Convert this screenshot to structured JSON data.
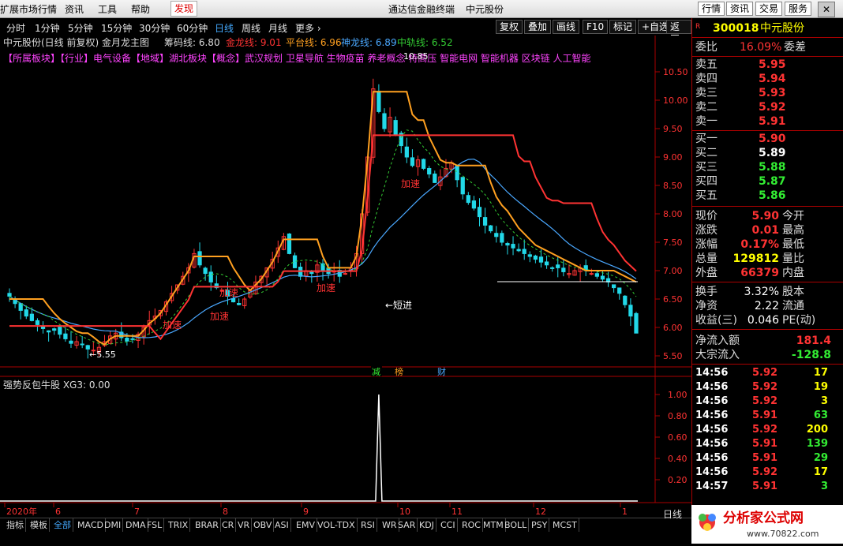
{
  "menubar": {
    "items": [
      "扩展市场行情",
      "资讯",
      "工具",
      "帮助"
    ],
    "active": "发现",
    "title_app": "通达信金融终端",
    "title_stock": "中元股份",
    "right_buttons": [
      "行情",
      "资讯",
      "交易",
      "服务"
    ]
  },
  "periods": [
    "分时",
    "1分钟",
    "5分钟",
    "15分钟",
    "30分钟",
    "60分钟",
    "日线",
    "周线",
    "月线",
    "更多 ›"
  ],
  "selected_period": "日线",
  "toolbar": [
    "复权",
    "叠加",
    "画线",
    "F10",
    "标记",
    "+自选",
    "返回"
  ],
  "chart_header": {
    "title": "中元股份(日线 前复权) 金月龙主图",
    "chouma": "筹码线: 6.80",
    "jinlong": "金龙线: 9.01",
    "pingtai": "平台线: 6.96",
    "shenlong": "神龙线: 6.89",
    "zhonggui": "中轨线: 6.52"
  },
  "concepts": "【所属板块】【行业】电气设备【地域】湖北板块【概念】武汉规划 卫星导航 生物疫苗 养老概念 特高压 智能电网 智能机器 区块链 人工智能",
  "annotations": {
    "high": "10.85",
    "low": "←5.55",
    "short_entry": "←短进",
    "accel": "加速"
  },
  "event_markers": [
    "减",
    "榜",
    "财"
  ],
  "sub_indicator": "强势反包牛股 XG3: 0.00",
  "colors": {
    "up": "#ff3333",
    "down": "#22d8e8",
    "gold": "#ffa020",
    "ma_blue": "#4aa8ff",
    "ma_green": "#33cc33",
    "text_yellow": "#ffff00",
    "text_cyan": "#00dddd",
    "text_magenta": "#ff44ff"
  },
  "chart_data": {
    "type": "line",
    "title": "",
    "x_axis_labels": [
      "2020年",
      "6",
      "7",
      "8",
      "9",
      "10",
      "11",
      "12",
      "1"
    ],
    "price_ticks": [
      "10.50",
      "10.00",
      "9.50",
      "9.00",
      "8.50",
      "8.00",
      "7.50",
      "7.00",
      "6.50",
      "6.00",
      "5.50"
    ],
    "ylim": [
      5.4,
      10.9
    ],
    "sub_ticks": [
      "1.00",
      "0.80",
      "0.60",
      "0.40",
      "0.20"
    ],
    "sub_ylim": [
      0,
      1.05
    ],
    "sub_signal": {
      "series": "XG3",
      "spike_month": "10",
      "value": 1.0
    },
    "series": [
      {
        "kind": "candles",
        "close": [
          6.55,
          6.42,
          6.3,
          6.2,
          6.12,
          6.05,
          5.98,
          5.92,
          5.95,
          5.88,
          5.8,
          5.72,
          5.75,
          5.7,
          5.62,
          5.6,
          5.65,
          5.75,
          5.85,
          5.9,
          5.82,
          5.76,
          5.8,
          5.88,
          6.0,
          6.12,
          6.2,
          6.3,
          6.45,
          6.6,
          6.75,
          6.9,
          7.05,
          7.3,
          7.1,
          6.95,
          6.8,
          6.7,
          6.65,
          6.55,
          6.45,
          6.4,
          6.5,
          6.65,
          6.8,
          6.9,
          7.05,
          7.2,
          7.4,
          7.6,
          7.3,
          7.05,
          6.9,
          7.0,
          6.95,
          7.1,
          7.0,
          6.95,
          7.0,
          6.9,
          6.95,
          7.05,
          7.3,
          8.0,
          9.0,
          10.2,
          9.8,
          9.5,
          9.7,
          9.4,
          9.2,
          9.0,
          8.85,
          8.95,
          8.8,
          8.7,
          8.55,
          8.65,
          8.8,
          8.9,
          8.6,
          8.35,
          8.2,
          8.1,
          7.95,
          7.8,
          7.7,
          7.6,
          7.5,
          7.45,
          7.4,
          7.35,
          7.3,
          7.25,
          7.2,
          7.15,
          7.1,
          7.05,
          7.05,
          6.98,
          6.95,
          7.0,
          7.05,
          7.0,
          6.95,
          6.9,
          6.85,
          6.8,
          6.7,
          6.6,
          6.4,
          6.2,
          5.9
        ]
      },
      {
        "name": "金龙线",
        "value": 9.01
      },
      {
        "name": "平台线",
        "value": 6.96
      },
      {
        "name": "神龙线",
        "value": 6.89
      },
      {
        "name": "中轨线",
        "value": 6.52
      }
    ]
  },
  "quote": {
    "code": "300018",
    "name": "中元股份",
    "weibi_label": "委比",
    "weibi_value": "16.09%",
    "weicha_label": "委差",
    "asks": [
      {
        "label": "卖五",
        "price": "5.95"
      },
      {
        "label": "卖四",
        "price": "5.94"
      },
      {
        "label": "卖三",
        "price": "5.93"
      },
      {
        "label": "卖二",
        "price": "5.92"
      },
      {
        "label": "卖一",
        "price": "5.91"
      }
    ],
    "bids": [
      {
        "label": "买一",
        "price": "5.90"
      },
      {
        "label": "买二",
        "price": "5.89"
      },
      {
        "label": "买三",
        "price": "5.88"
      },
      {
        "label": "买四",
        "price": "5.87"
      },
      {
        "label": "买五",
        "price": "5.86"
      }
    ],
    "stats": [
      {
        "l": "现价",
        "v": "5.90",
        "r": "今开",
        "c": "#ff3333"
      },
      {
        "l": "涨跌",
        "v": "0.01",
        "r": "最高",
        "c": "#ff3333"
      },
      {
        "l": "涨幅",
        "v": "0.17%",
        "r": "最低",
        "c": "#ff3333"
      },
      {
        "l": "总量",
        "v": "129812",
        "r": "量比",
        "c": "#ffff00"
      },
      {
        "l": "外盘",
        "v": "66379",
        "r": "内盘",
        "c": "#ff3333"
      }
    ],
    "stats2": [
      {
        "l": "换手",
        "v": "3.32%",
        "r": "股本"
      },
      {
        "l": "净资",
        "v": "2.22",
        "r": "流通"
      },
      {
        "l": "收益(三)",
        "v": "0.046",
        "r": "PE(动)"
      }
    ],
    "flow": [
      {
        "l": "净流入额",
        "v": "181.4",
        "c": "#ff3333"
      },
      {
        "l": "大宗流入",
        "v": "-128.8",
        "c": "#33ee33"
      }
    ],
    "ticks": [
      {
        "t": "14:56",
        "p": "5.92",
        "v": "17",
        "pc": "#ff3333",
        "vc": "#ffff00"
      },
      {
        "t": "14:56",
        "p": "5.92",
        "v": "19",
        "pc": "#ff3333",
        "vc": "#ffff00"
      },
      {
        "t": "14:56",
        "p": "5.92",
        "v": "3",
        "pc": "#ff3333",
        "vc": "#ffff00"
      },
      {
        "t": "14:56",
        "p": "5.91",
        "v": "63",
        "pc": "#ff3333",
        "vc": "#33ee33"
      },
      {
        "t": "14:56",
        "p": "5.92",
        "v": "200",
        "pc": "#ff3333",
        "vc": "#ffff00"
      },
      {
        "t": "14:56",
        "p": "5.91",
        "v": "139",
        "pc": "#ff3333",
        "vc": "#33ee33"
      },
      {
        "t": "14:56",
        "p": "5.91",
        "v": "29",
        "pc": "#ff3333",
        "vc": "#33ee33"
      },
      {
        "t": "14:56",
        "p": "5.92",
        "v": "17",
        "pc": "#ff3333",
        "vc": "#ffff00"
      },
      {
        "t": "14:57",
        "p": "5.91",
        "v": "3",
        "pc": "#ff3333",
        "vc": "#33ee33"
      }
    ]
  },
  "bottom_tabs": [
    "指标",
    "模板",
    "全部",
    "MACD",
    "DMI",
    "DMA",
    "FSL",
    "TRIX",
    "BRAR",
    "CR",
    "VR",
    "OBV",
    "ASI",
    "EMV",
    "VOL-TDX",
    "RSI",
    "WR",
    "SAR",
    "KDJ",
    "CCI",
    "ROC",
    "MTM",
    "BOLL",
    "PSY",
    "MCST"
  ],
  "bottom_selected": "全部",
  "right_label": "日线",
  "logo": {
    "text": "分析家公式网",
    "url": "www.70822.com"
  }
}
